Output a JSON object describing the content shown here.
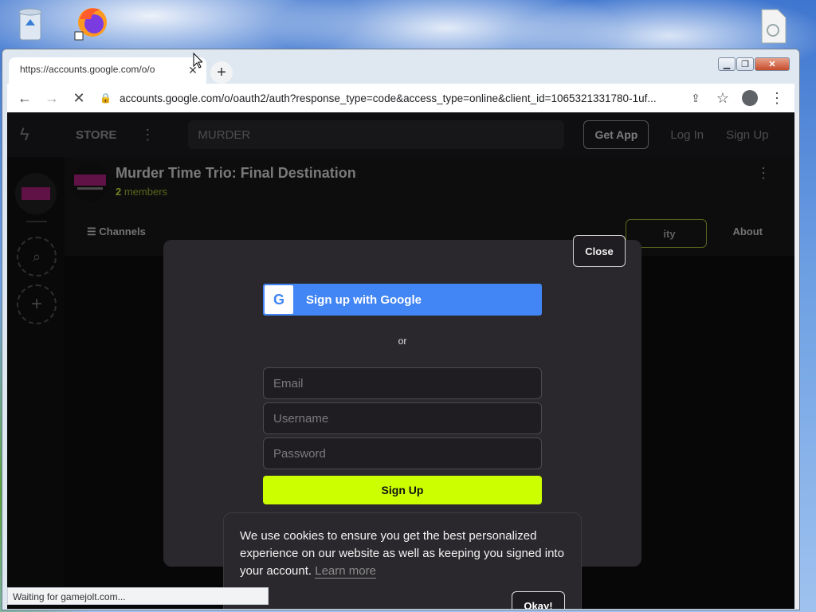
{
  "browser": {
    "tab_title": "https://accounts.google.com/o/o",
    "address": "accounts.google.com/o/oauth2/auth?response_type=code&access_type=online&client_id=1065321331780-1uf...",
    "status": "Waiting for gamejolt.com..."
  },
  "site": {
    "store": "STORE",
    "search_value": "MURDER",
    "get_app": "Get App",
    "login": "Log In",
    "signup": "Sign Up"
  },
  "group": {
    "title": "Murder Time Trio: Final Destination",
    "member_count": "2",
    "member_suffix": " members",
    "channels": "Channels",
    "community_partial": "ity",
    "about": "About"
  },
  "modal": {
    "close": "Close",
    "google": "Sign up with Google",
    "or": "or",
    "email_placeholder": "Email",
    "username_placeholder": "Username",
    "password_placeholder": "Password",
    "submit": "Sign Up"
  },
  "cookie": {
    "message": "We use cookies to ensure you get the best personalized experience on our website as well as keeping you signed into your account.",
    "learn_more": "Learn more",
    "okay": "Okay!"
  },
  "colors": {
    "accent": "#ccff00",
    "google_blue": "#4285f4"
  }
}
